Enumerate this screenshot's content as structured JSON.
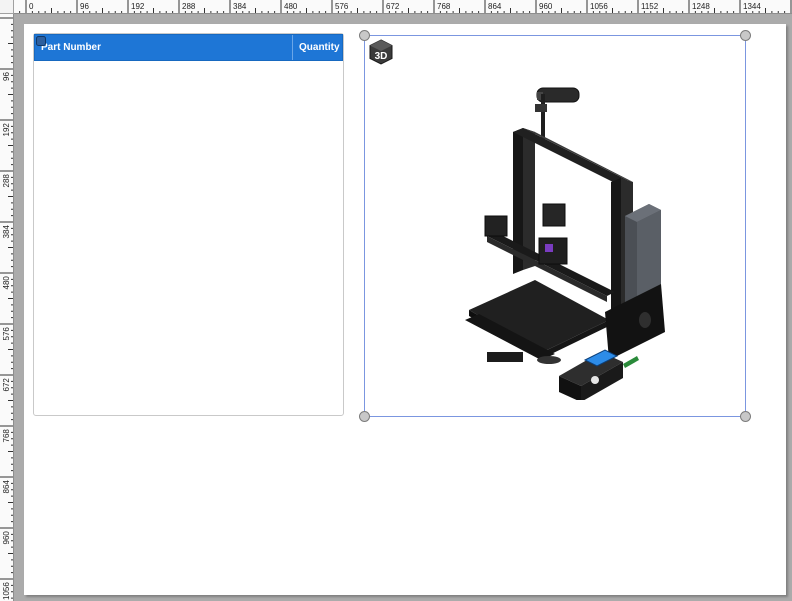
{
  "ruler": {
    "top_labels": [
      "0",
      "96",
      "192",
      "288",
      "384",
      "480",
      "576",
      "672",
      "768",
      "864",
      "960",
      "1056",
      "1152",
      "1248",
      "1344"
    ],
    "left_labels": [
      "96",
      "192",
      "288",
      "384",
      "480",
      "576",
      "672",
      "768",
      "864",
      "960",
      "1056"
    ]
  },
  "bom": {
    "columns": {
      "part_number": "Part Number",
      "quantity": "Quantity"
    },
    "rows": []
  },
  "view3d": {
    "badge_text": "3D",
    "model_icon": "3d-printer-model",
    "selection_color": "#7b96e0"
  },
  "colors": {
    "header_blue": "#1e76d6",
    "sheet": "#ffffff",
    "workspace": "#ababab"
  }
}
